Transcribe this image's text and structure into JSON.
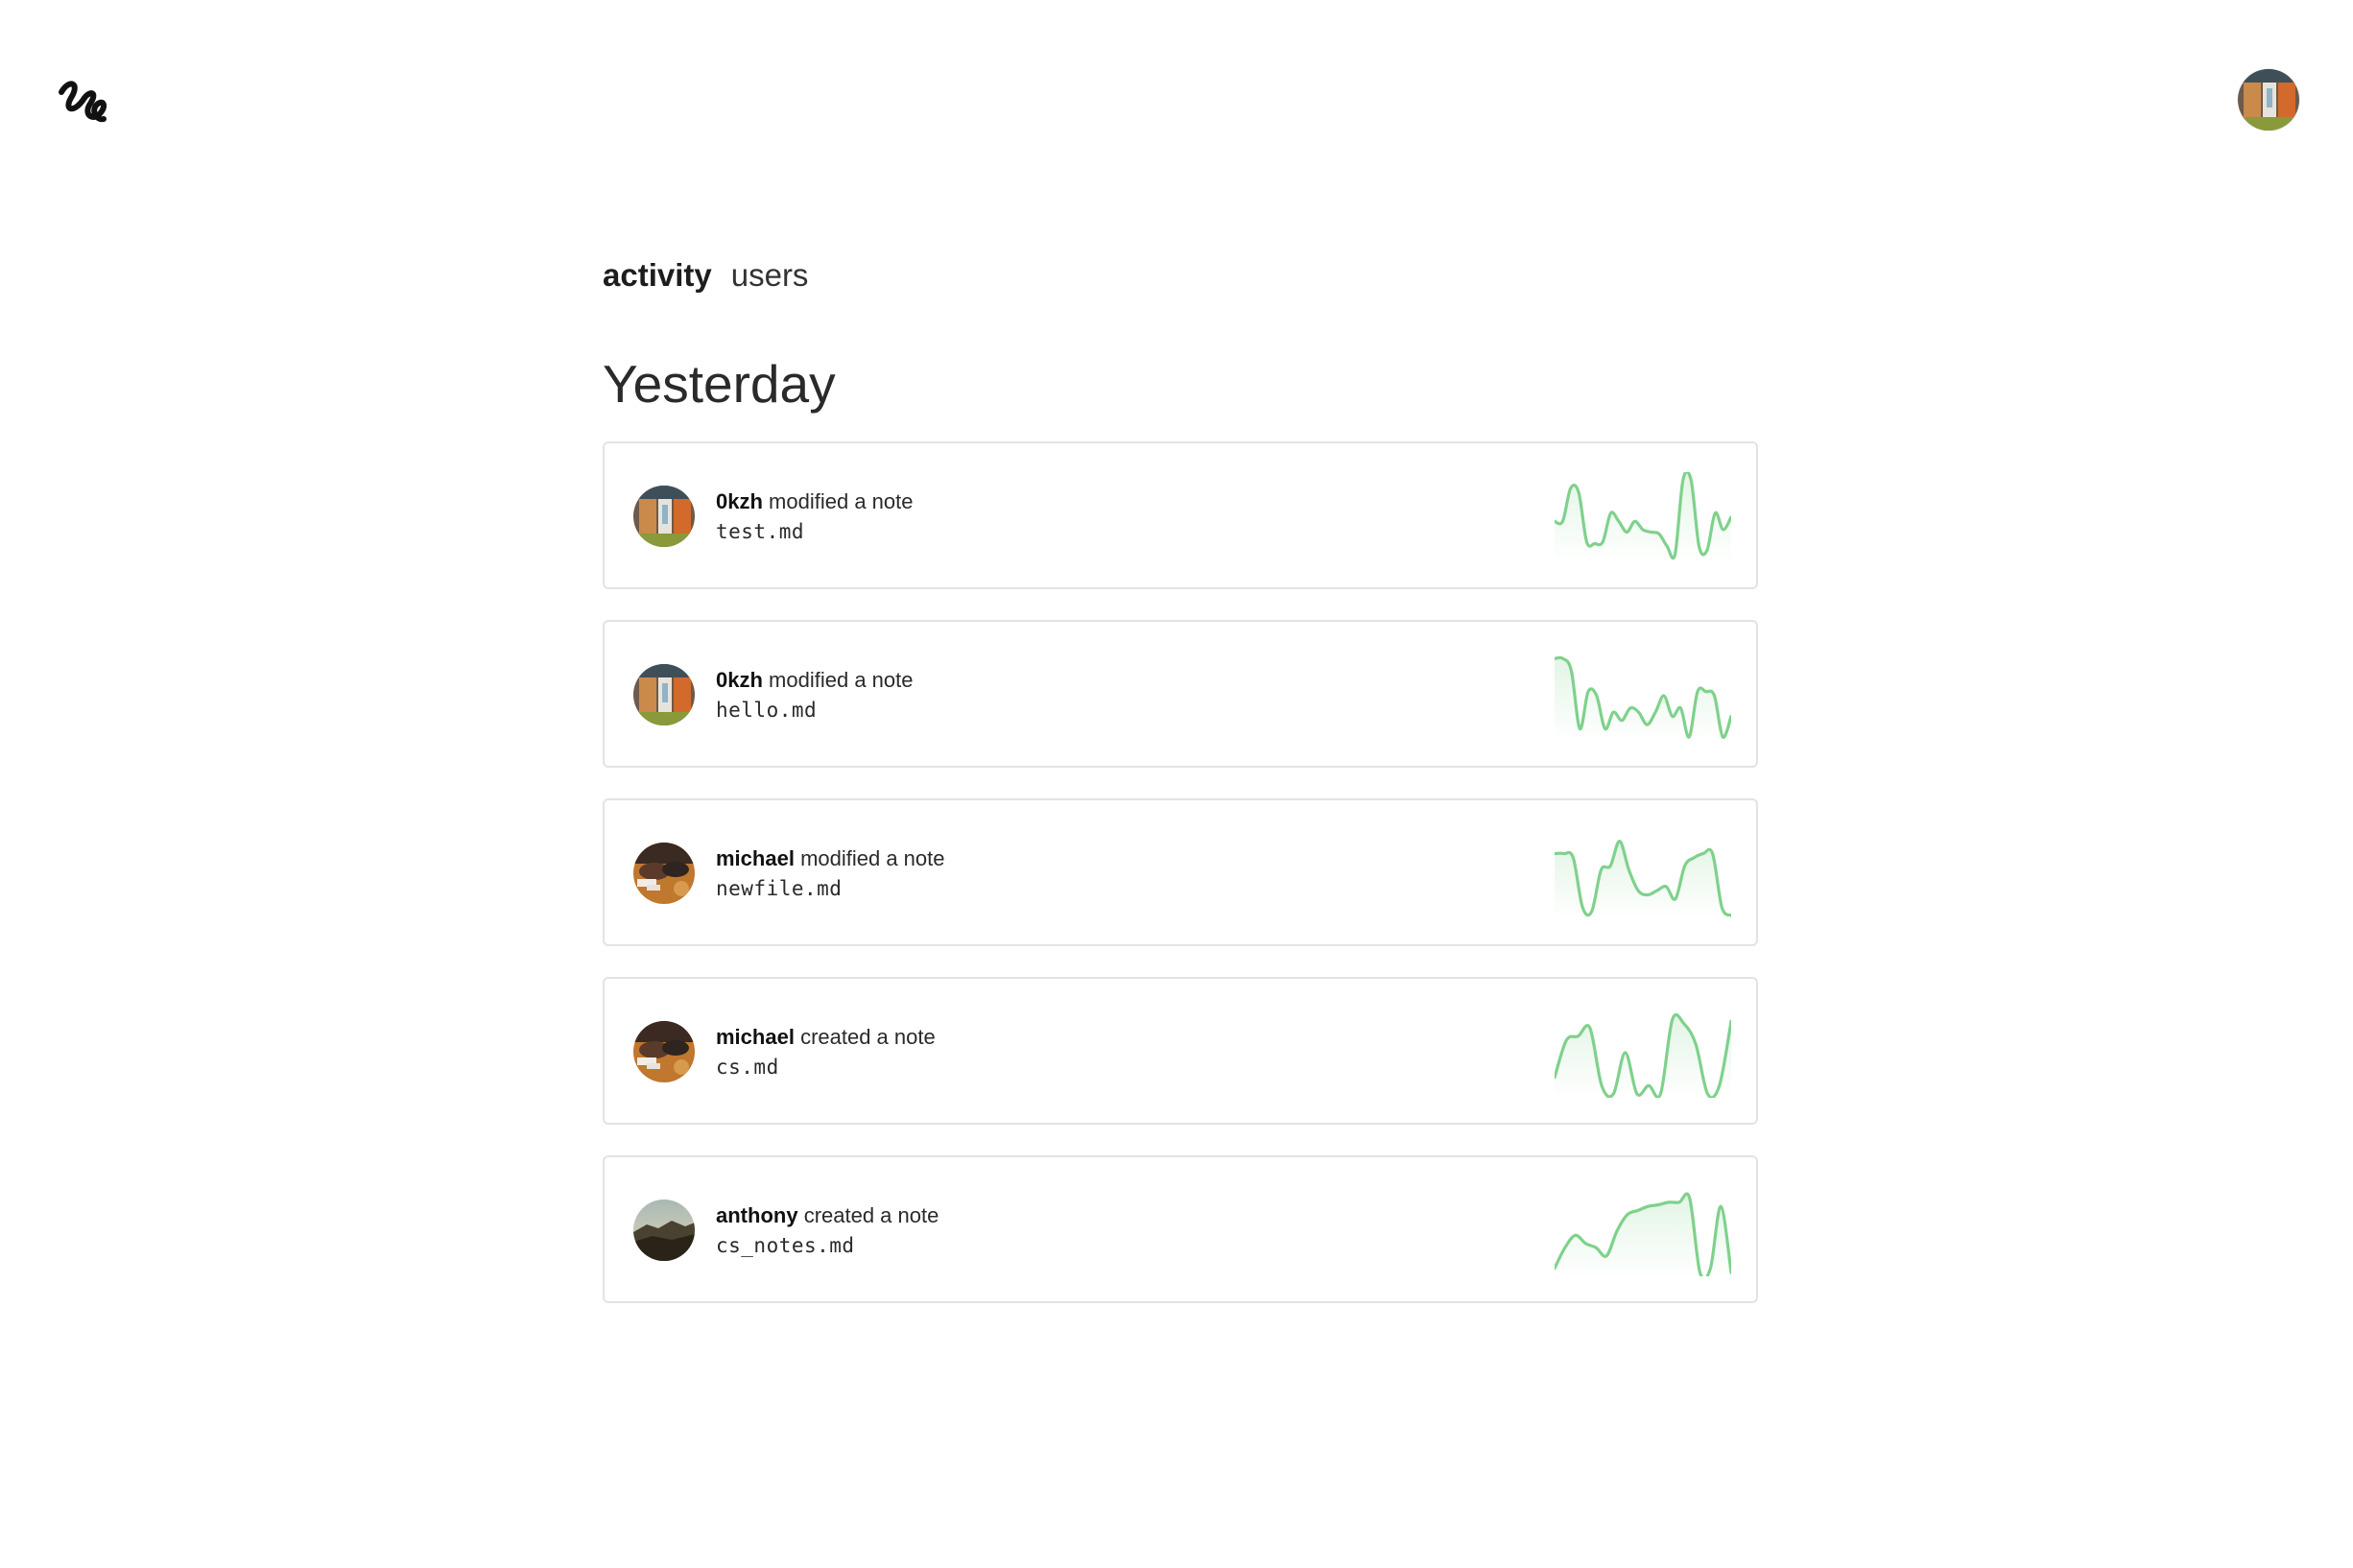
{
  "app": {
    "logo_icon": "squiggle-logo-icon",
    "accent_color": "#7fd18c"
  },
  "nav": {
    "tabs": [
      {
        "label": "activity",
        "active": true
      },
      {
        "label": "users",
        "active": false
      }
    ]
  },
  "section": {
    "title": "Yesterday"
  },
  "activities": [
    {
      "user": "0kzh",
      "action": "modified a note",
      "file": "test.md",
      "avatar": "storefront-photo",
      "spark": [
        0.45,
        0.45,
        0.85,
        0.8,
        0.2,
        0.18,
        0.2,
        0.55,
        0.45,
        0.32,
        0.45,
        0.35,
        0.32,
        0.3,
        0.15,
        0.05,
        0.95,
        0.95,
        0.15,
        0.1,
        0.55,
        0.35,
        0.5
      ]
    },
    {
      "user": "0kzh",
      "action": "modified a note",
      "file": "hello.md",
      "avatar": "storefront-photo",
      "spark": [
        0.95,
        0.95,
        0.8,
        0.1,
        0.55,
        0.5,
        0.1,
        0.3,
        0.2,
        0.35,
        0.3,
        0.15,
        0.3,
        0.5,
        0.25,
        0.35,
        0.0,
        0.55,
        0.55,
        0.5,
        0.0,
        0.25
      ]
    },
    {
      "user": "michael",
      "action": "modified a note",
      "file": "newfile.md",
      "avatar": "food-photo",
      "spark": [
        0.75,
        0.75,
        0.7,
        0.1,
        0.05,
        0.55,
        0.6,
        0.9,
        0.55,
        0.3,
        0.25,
        0.3,
        0.35,
        0.2,
        0.6,
        0.7,
        0.75,
        0.75,
        0.1,
        0.0
      ]
    },
    {
      "user": "michael",
      "action": "created a note",
      "file": "cs.md",
      "avatar": "food-photo",
      "spark": [
        0.2,
        0.65,
        0.7,
        0.8,
        0.1,
        0.0,
        0.5,
        0.0,
        0.1,
        0.0,
        0.9,
        0.85,
        0.6,
        0.0,
        0.1,
        0.88
      ]
    },
    {
      "user": "anthony",
      "action": "created a note",
      "file": "cs_notes.md",
      "avatar": "landscape-photo",
      "spark": [
        0.05,
        0.3,
        0.45,
        0.35,
        0.3,
        0.2,
        0.5,
        0.7,
        0.75,
        0.8,
        0.82,
        0.85,
        0.85,
        0.9,
        0.0,
        0.05,
        0.8,
        0.0
      ]
    }
  ],
  "profile": {
    "avatar": "storefront-photo"
  }
}
